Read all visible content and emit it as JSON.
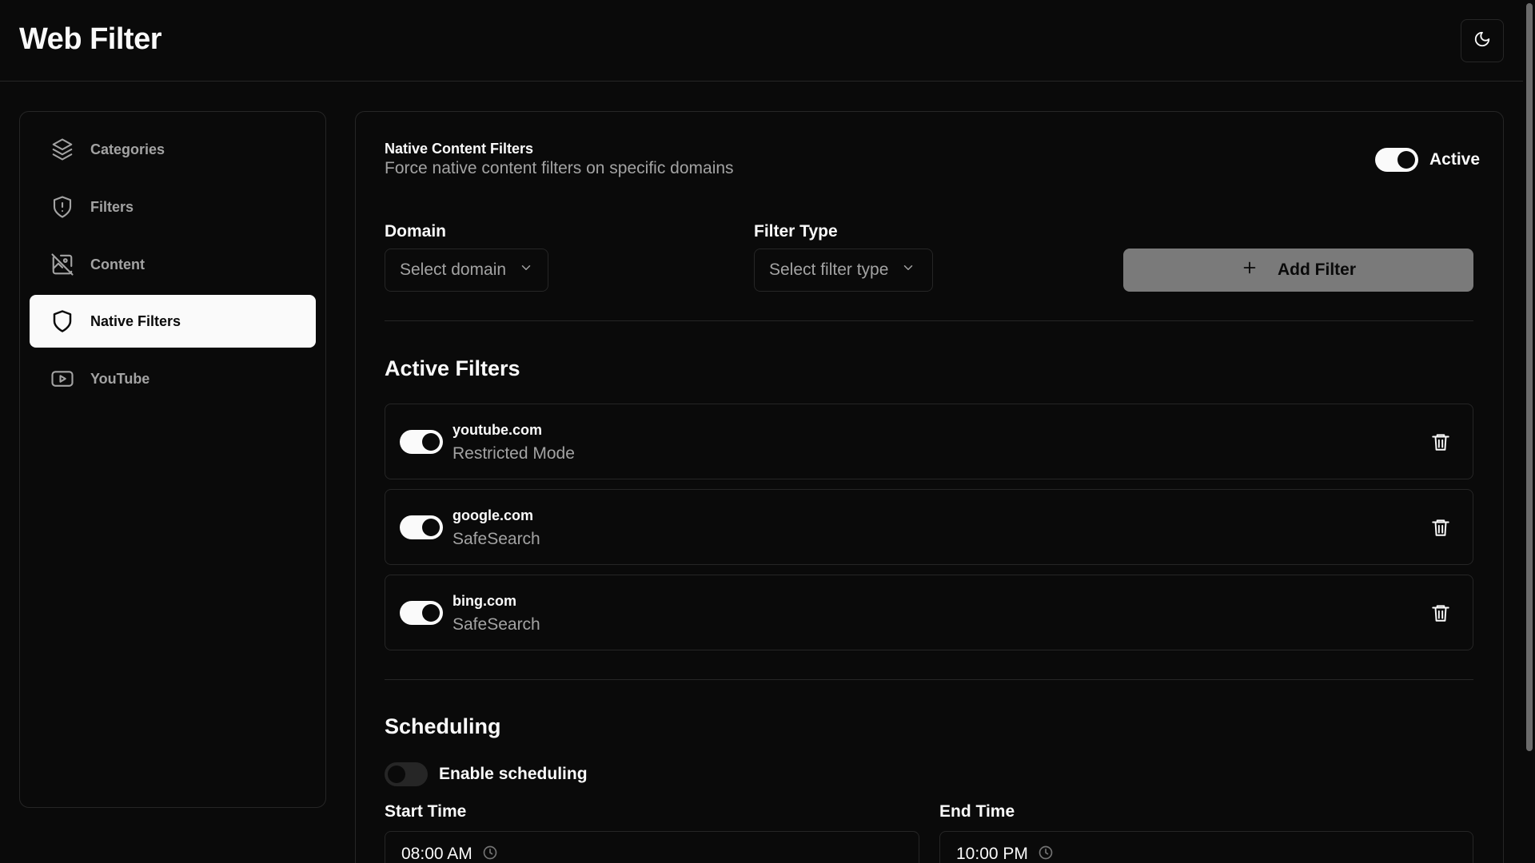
{
  "header": {
    "title": "Web Filter",
    "theme_icon": "moon-icon"
  },
  "sidebar": {
    "items": [
      {
        "label": "Categories",
        "icon": "layers-icon"
      },
      {
        "label": "Filters",
        "icon": "shield-alert-icon"
      },
      {
        "label": "Content",
        "icon": "image-off-icon"
      },
      {
        "label": "Native Filters",
        "icon": "shield-icon",
        "active": true
      },
      {
        "label": "YouTube",
        "icon": "youtube-icon"
      }
    ]
  },
  "main": {
    "title": "Native Content Filters",
    "description": "Force native content filters on specific domains",
    "master_toggle": {
      "label": "Active",
      "on": true
    },
    "domain": {
      "label": "Domain",
      "placeholder": "Select domain"
    },
    "filter_type": {
      "label": "Filter Type",
      "placeholder": "Select filter type"
    },
    "add_button": {
      "label": "Add Filter",
      "icon": "plus-icon"
    },
    "active_filters": {
      "title": "Active Filters",
      "items": [
        {
          "domain": "youtube.com",
          "type": "Restricted Mode",
          "on": true
        },
        {
          "domain": "google.com",
          "type": "SafeSearch",
          "on": true
        },
        {
          "domain": "bing.com",
          "type": "SafeSearch",
          "on": true
        }
      ]
    },
    "scheduling": {
      "title": "Scheduling",
      "enable_label": "Enable scheduling",
      "enabled": false,
      "start": {
        "label": "Start Time",
        "value": "08:00 AM"
      },
      "end": {
        "label": "End Time",
        "value": "10:00 PM"
      }
    }
  },
  "colors": {
    "background": "#0a0a0a",
    "border": "#262626",
    "foreground": "#fafafa",
    "muted": "#a3a3a3",
    "button_disabled": "#7a7a7a"
  }
}
